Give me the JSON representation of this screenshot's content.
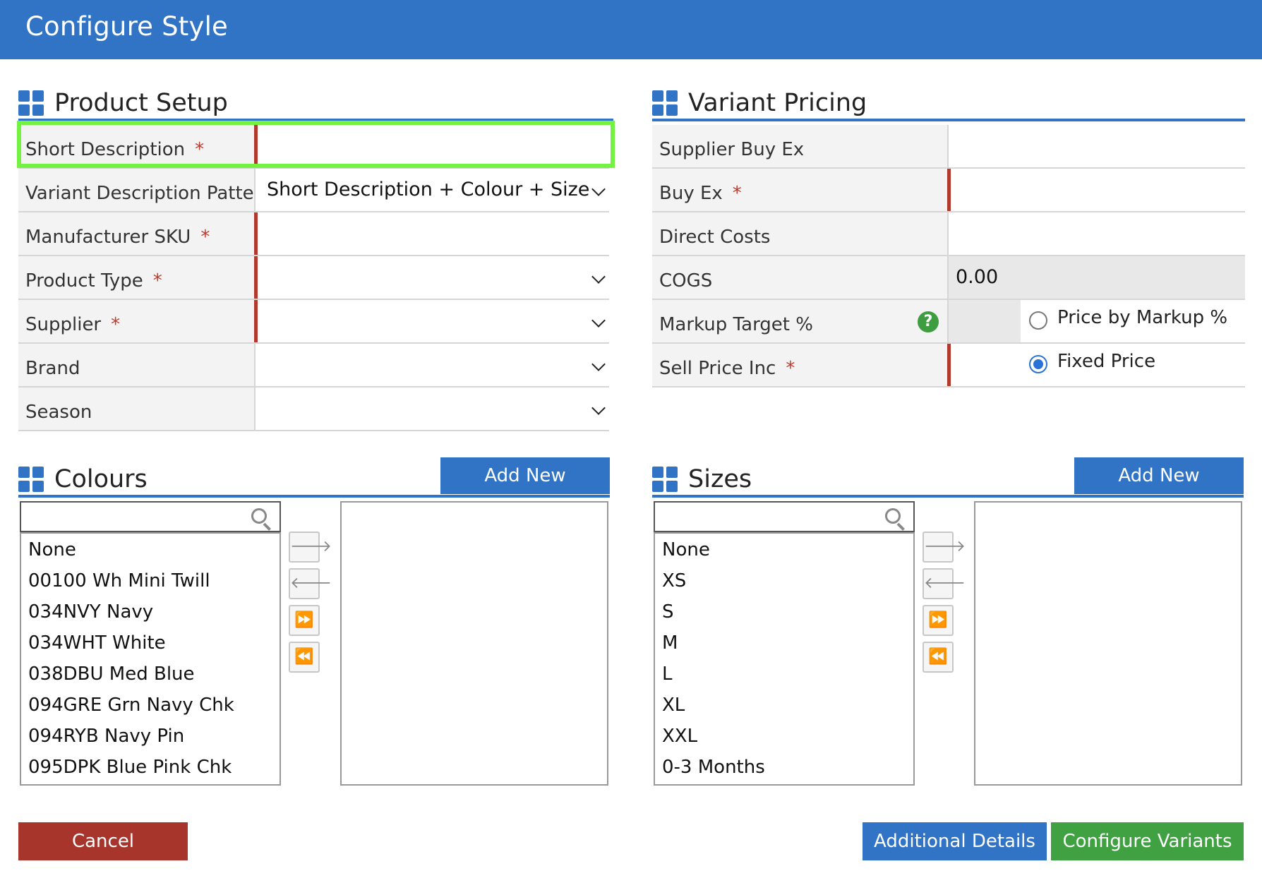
{
  "window": {
    "title": "Configure Style"
  },
  "product_setup": {
    "title": "Product Setup",
    "fields": [
      {
        "label": "Short Description",
        "required": true,
        "value": "",
        "type": "text"
      },
      {
        "label": "Variant Description Pattern",
        "required": false,
        "value": "Short Description + Colour + Size",
        "type": "select"
      },
      {
        "label": "Manufacturer SKU",
        "required": true,
        "value": "",
        "type": "text"
      },
      {
        "label": "Product Type",
        "required": true,
        "value": "",
        "type": "select"
      },
      {
        "label": "Supplier",
        "required": true,
        "value": "",
        "type": "select"
      },
      {
        "label": "Brand",
        "required": false,
        "value": "",
        "type": "select"
      },
      {
        "label": "Season",
        "required": false,
        "value": "",
        "type": "select"
      }
    ],
    "required_mark": "*"
  },
  "variant_pricing": {
    "title": "Variant Pricing",
    "fields": [
      {
        "label": "Supplier Buy Ex",
        "required": false,
        "value": ""
      },
      {
        "label": "Buy Ex",
        "required": true,
        "value": ""
      },
      {
        "label": "Direct Costs",
        "required": false,
        "value": ""
      },
      {
        "label": "COGS",
        "required": false,
        "value": "0.00"
      },
      {
        "label": "Markup Target %",
        "required": false,
        "value": ""
      },
      {
        "label": "Sell Price Inc",
        "required": true,
        "value": ""
      }
    ],
    "help_icon": "?",
    "pricing_mode": {
      "options": [
        {
          "label": "Price by Markup %",
          "checked": false
        },
        {
          "label": "Fixed Price",
          "checked": true
        }
      ]
    }
  },
  "colours": {
    "title": "Colours",
    "add_new_label": "Add New",
    "search_placeholder": "",
    "available": [
      "None",
      "00100 Wh Mini Twill",
      "034NVY Navy",
      "034WHT White",
      "038DBU Med Blue",
      "094GRE Grn Navy Chk",
      "094RYB Navy Pin",
      "095DPK Blue Pink Chk"
    ],
    "selected": []
  },
  "sizes": {
    "title": "Sizes",
    "add_new_label": "Add New",
    "search_placeholder": "",
    "available": [
      "None",
      "XS",
      "S",
      "M",
      "L",
      "XL",
      "XXL",
      "0-3 Months"
    ],
    "selected": []
  },
  "move_buttons": {
    "add_one": "🡒",
    "remove_one": "🡐",
    "add_all": "⏩",
    "remove_all": "⏪"
  },
  "footer": {
    "cancel_label": "Cancel",
    "additional_details_label": "Additional Details",
    "configure_variants_label": "Configure Variants"
  },
  "colors": {
    "primary": "#3173c4",
    "danger": "#a8352c",
    "success": "#3fa141",
    "highlight": "#73f240"
  }
}
